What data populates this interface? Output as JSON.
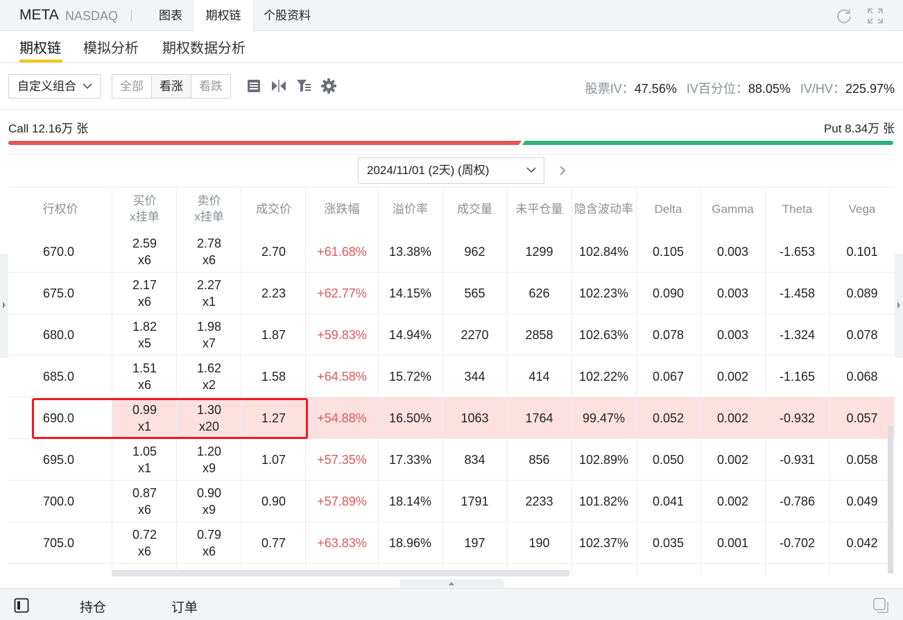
{
  "header": {
    "ticker": "META",
    "exchange": "NASDAQ",
    "tabs": [
      "图表",
      "期权链",
      "个股资料"
    ],
    "active_tab": "期权链",
    "icons": [
      "refresh-icon",
      "fullscreen-icon"
    ]
  },
  "subtabs": {
    "items": [
      "期权链",
      "模拟分析",
      "期权数据分析"
    ],
    "active": "期权链"
  },
  "toolbar": {
    "combo_label": "自定义组合",
    "filter": [
      "全部",
      "看涨",
      "看跌"
    ],
    "filter_selected": "看涨",
    "icons": [
      "layout-icon",
      "split-icon",
      "column-filter-icon",
      "settings-icon"
    ],
    "iv_label": "股票IV：",
    "iv_value": "47.56%",
    "ivpct_label": "IV百分位：",
    "ivpct_value": "88.05%",
    "ivhv_label": "IV/HV：",
    "ivhv_value": "225.97%"
  },
  "volume": {
    "call_label": "Call 12.16万 张",
    "put_label": "Put 8.34万 张",
    "call_color": "#e25757",
    "put_color": "#2db27a"
  },
  "expiry": {
    "label": "2024/11/01 (2天) (周权)"
  },
  "table": {
    "headers": {
      "strike": "行权价",
      "bid": "买价\nx挂单",
      "ask": "卖价\nx挂单",
      "last": "成交价",
      "change": "涨跌幅",
      "premium": "溢价率",
      "volume": "成交量",
      "oi": "未平仓量",
      "iv": "隐含波动率",
      "delta": "Delta",
      "gamma": "Gamma",
      "theta": "Theta",
      "vega": "Vega"
    },
    "rows": [
      {
        "strike": "670.0",
        "bid": "2.59",
        "bid_size": "x6",
        "ask": "2.78",
        "ask_size": "x6",
        "last": "2.70",
        "change": "+61.68%",
        "premium": "13.38%",
        "volume": "962",
        "oi": "1299",
        "iv": "102.84%",
        "delta": "0.105",
        "gamma": "0.003",
        "theta": "-1.653",
        "vega": "0.101"
      },
      {
        "strike": "675.0",
        "bid": "2.17",
        "bid_size": "x6",
        "ask": "2.27",
        "ask_size": "x1",
        "last": "2.23",
        "change": "+62.77%",
        "premium": "14.15%",
        "volume": "565",
        "oi": "626",
        "iv": "102.23%",
        "delta": "0.090",
        "gamma": "0.003",
        "theta": "-1.458",
        "vega": "0.089"
      },
      {
        "strike": "680.0",
        "bid": "1.82",
        "bid_size": "x5",
        "ask": "1.98",
        "ask_size": "x7",
        "last": "1.87",
        "change": "+59.83%",
        "premium": "14.94%",
        "volume": "2270",
        "oi": "2858",
        "iv": "102.63%",
        "delta": "0.078",
        "gamma": "0.003",
        "theta": "-1.324",
        "vega": "0.078"
      },
      {
        "strike": "685.0",
        "bid": "1.51",
        "bid_size": "x6",
        "ask": "1.62",
        "ask_size": "x2",
        "last": "1.58",
        "change": "+64.58%",
        "premium": "15.72%",
        "volume": "344",
        "oi": "414",
        "iv": "102.22%",
        "delta": "0.067",
        "gamma": "0.002",
        "theta": "-1.165",
        "vega": "0.068"
      },
      {
        "strike": "690.0",
        "bid": "0.99",
        "bid_size": "x1",
        "ask": "1.30",
        "ask_size": "x20",
        "last": "1.27",
        "change": "+54.88%",
        "premium": "16.50%",
        "volume": "1063",
        "oi": "1764",
        "iv": "99.47%",
        "delta": "0.052",
        "gamma": "0.002",
        "theta": "-0.932",
        "vega": "0.057",
        "highlighted": true
      },
      {
        "strike": "695.0",
        "bid": "1.05",
        "bid_size": "x1",
        "ask": "1.20",
        "ask_size": "x9",
        "last": "1.07",
        "change": "+57.35%",
        "premium": "17.33%",
        "volume": "834",
        "oi": "856",
        "iv": "102.89%",
        "delta": "0.050",
        "gamma": "0.002",
        "theta": "-0.931",
        "vega": "0.058"
      },
      {
        "strike": "700.0",
        "bid": "0.87",
        "bid_size": "x6",
        "ask": "0.90",
        "ask_size": "x9",
        "last": "0.90",
        "change": "+57.89%",
        "premium": "18.14%",
        "volume": "1791",
        "oi": "2233",
        "iv": "101.82%",
        "delta": "0.041",
        "gamma": "0.002",
        "theta": "-0.786",
        "vega": "0.049"
      },
      {
        "strike": "705.0",
        "bid": "0.72",
        "bid_size": "x6",
        "ask": "0.79",
        "ask_size": "x6",
        "last": "0.77",
        "change": "+63.83%",
        "premium": "18.96%",
        "volume": "197",
        "oi": "190",
        "iv": "102.37%",
        "delta": "0.035",
        "gamma": "0.001",
        "theta": "-0.702",
        "vega": "0.042"
      }
    ],
    "up_color": "#e25757",
    "highlight_color": "#fde1e1",
    "annotation_color": "#ee1b1b"
  },
  "bottombar": {
    "items": [
      "持仓",
      "订单"
    ],
    "icons": [
      "panel-toggle-icon",
      "window-icon"
    ]
  }
}
